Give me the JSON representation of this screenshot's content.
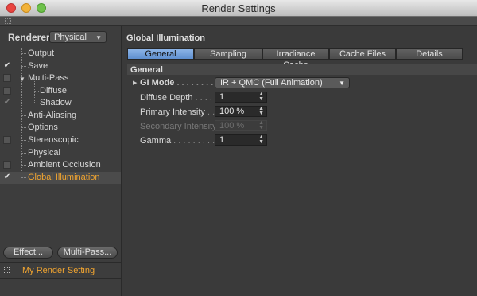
{
  "window": {
    "title": "Render Settings"
  },
  "renderer": {
    "label": "Renderer",
    "value": "Physical"
  },
  "tree": [
    {
      "label": "Output",
      "check": "none",
      "level": 1
    },
    {
      "label": "Save",
      "check": "checked",
      "level": 1
    },
    {
      "label": "Multi-Pass",
      "check": "box",
      "level": 1,
      "expanded": true
    },
    {
      "label": "Diffuse",
      "check": "box",
      "level": 2
    },
    {
      "label": "Shadow",
      "check": "checked-dim",
      "level": 2
    },
    {
      "label": "Anti-Aliasing",
      "check": "none",
      "level": 1
    },
    {
      "label": "Options",
      "check": "none",
      "level": 1
    },
    {
      "label": "Stereoscopic",
      "check": "box",
      "level": 1
    },
    {
      "label": "Physical",
      "check": "none",
      "level": 1
    },
    {
      "label": "Ambient Occlusion",
      "check": "box",
      "level": 1
    },
    {
      "label": "Global Illumination",
      "check": "checked",
      "level": 1,
      "active": true
    }
  ],
  "buttons": {
    "effect": "Effect...",
    "multipass": "Multi-Pass..."
  },
  "render_setting": {
    "name": "My Render Setting"
  },
  "panel": {
    "title": "Global Illumination",
    "tabs": [
      "General",
      "Sampling",
      "Irradiance Cache",
      "Cache Files",
      "Details"
    ],
    "active_tab": "General",
    "group": "General",
    "properties": {
      "gi_mode": {
        "label": "GI Mode",
        "dots": " . . . . . . . . .",
        "value": "IR + QMC (Full Animation)"
      },
      "diffuse_depth": {
        "label": "Diffuse Depth",
        "dots": " . . . . .",
        "value": "1"
      },
      "primary_intensity": {
        "label": "Primary Intensity",
        "dots": " . .",
        "value": "100 %"
      },
      "secondary_intensity": {
        "label": "Secondary Intensity",
        "dots": "",
        "value": "100 %"
      },
      "gamma": {
        "label": "Gamma",
        "dots": " . . . . . . . . . . .",
        "value": "1"
      }
    }
  },
  "colors": {
    "accent_orange": "#f2a530",
    "tab_active": "#6e9bd6",
    "panel_bg": "#3a3a3a"
  }
}
